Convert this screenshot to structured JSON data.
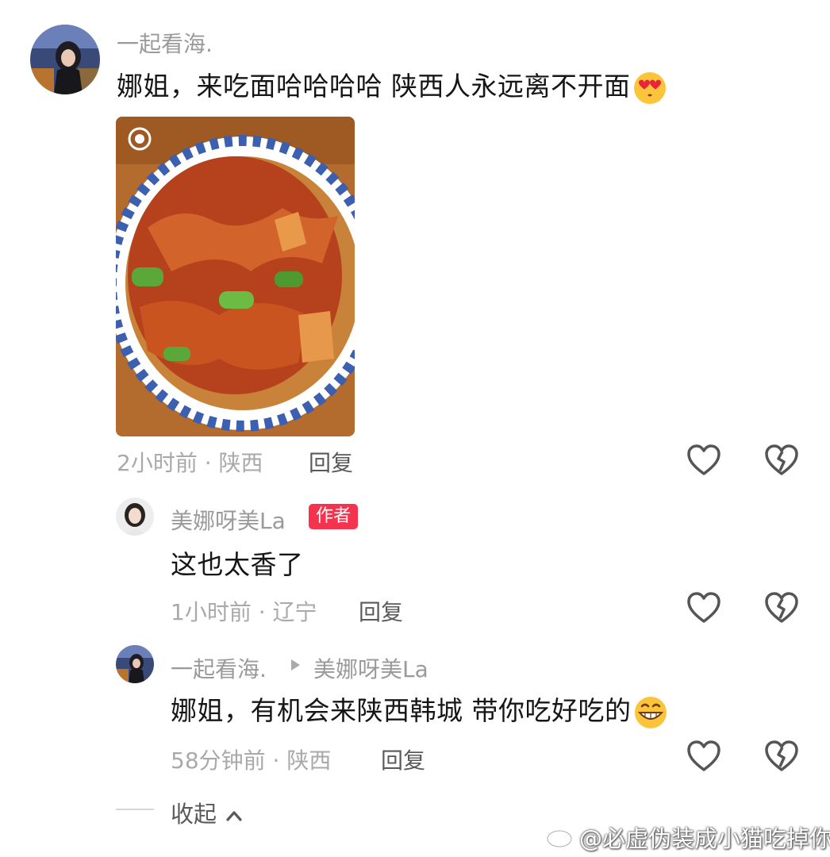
{
  "comment": {
    "username": "一起看海.",
    "text": "娜姐，来吃面哈哈哈哈 陕西人永远离不开面",
    "emoji": "heart-eyes-emoji",
    "meta": "2小时前 · 陕西",
    "reply_label": "回复"
  },
  "replies": [
    {
      "username": "美娜呀美La",
      "badge": "作者",
      "text": "这也太香了",
      "meta": "1小时前 · 辽宁",
      "reply_label": "回复"
    },
    {
      "username": "一起看海.",
      "reply_to": "美娜呀美La",
      "text": "娜姐，有机会来陕西韩城 带你吃好吃的",
      "emoji": "grinning-emoji",
      "meta": "58分钟前 · 陕西",
      "reply_label": "回复"
    }
  ],
  "collapse_label": "收起",
  "watermark": "@必虚伪装成小猫吃掉你",
  "colors": {
    "badge": "#f6334f",
    "meta": "#a9a9a9",
    "username": "#9a9a9a"
  }
}
